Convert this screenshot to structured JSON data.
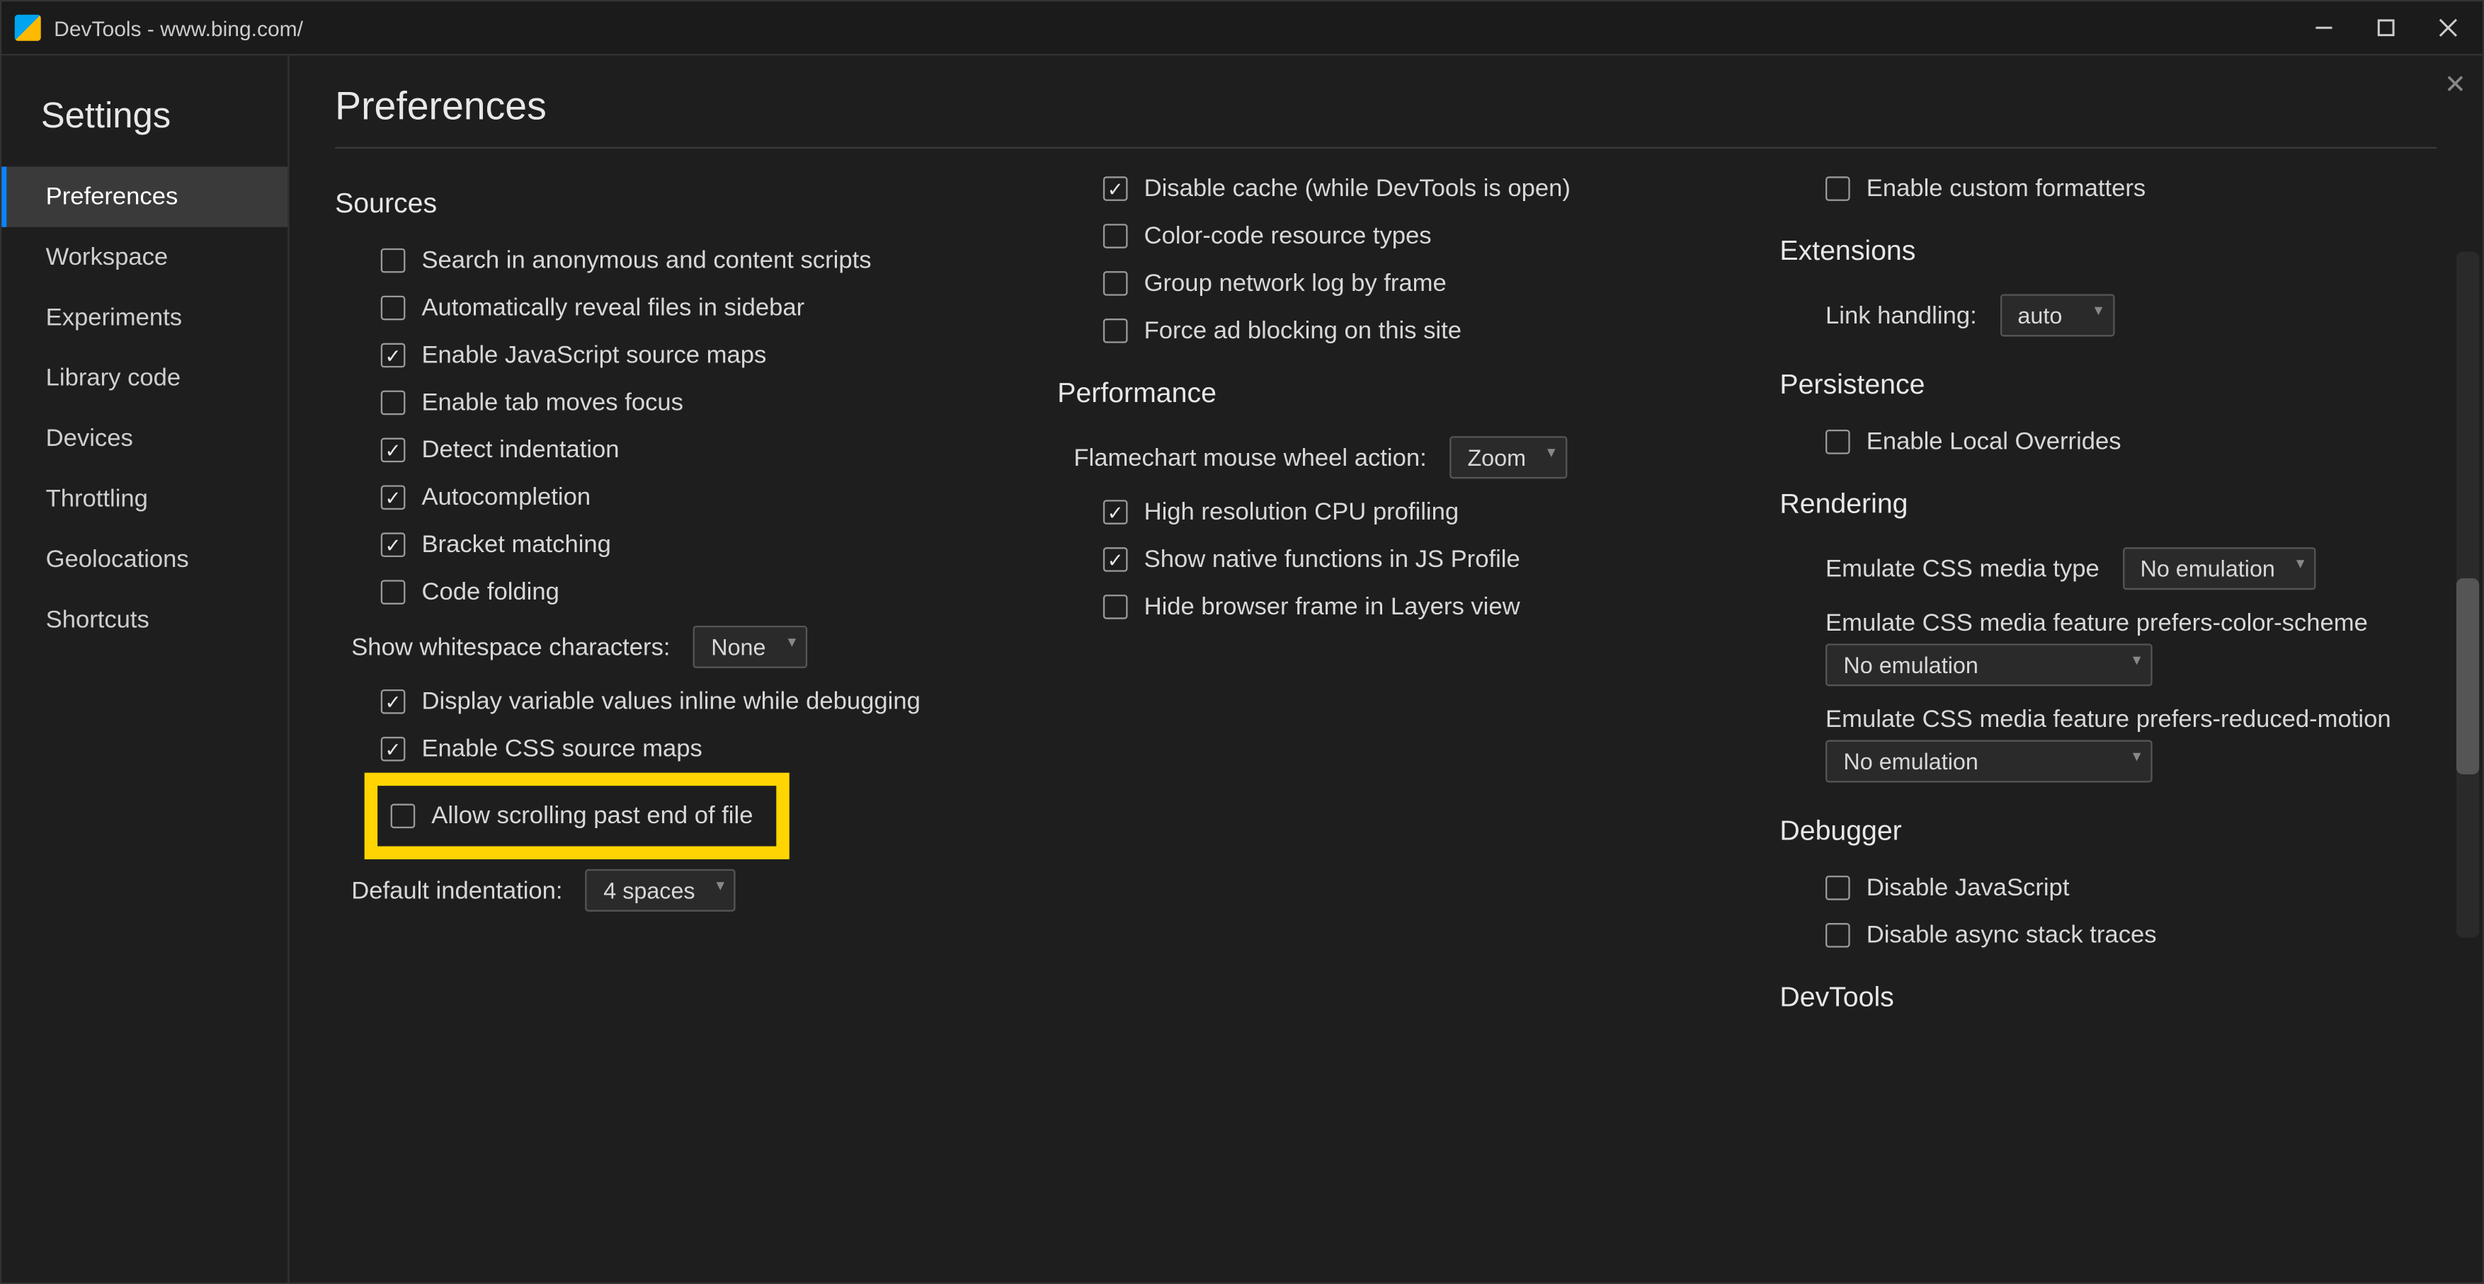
{
  "window": {
    "title": "DevTools - www.bing.com/"
  },
  "sidebar": {
    "title": "Settings",
    "items": [
      {
        "label": "Preferences",
        "selected": true
      },
      {
        "label": "Workspace"
      },
      {
        "label": "Experiments"
      },
      {
        "label": "Library code"
      },
      {
        "label": "Devices"
      },
      {
        "label": "Throttling"
      },
      {
        "label": "Geolocations"
      },
      {
        "label": "Shortcuts"
      }
    ]
  },
  "page": {
    "title": "Preferences"
  },
  "col1": {
    "section": "Sources",
    "items": {
      "search_anon": "Search in anonymous and content scripts",
      "auto_reveal": "Automatically reveal files in sidebar",
      "js_source_maps": "Enable JavaScript source maps",
      "tab_focus": "Enable tab moves focus",
      "detect_indent": "Detect indentation",
      "autocomplete": "Autocompletion",
      "bracket": "Bracket matching",
      "code_fold": "Code folding",
      "whitespace_label": "Show whitespace characters:",
      "whitespace_value": "None",
      "var_inline": "Display variable values inline while debugging",
      "css_source_maps": "Enable CSS source maps",
      "scroll_past": "Allow scrolling past end of file",
      "default_indent_label": "Default indentation:",
      "default_indent_value": "4 spaces"
    }
  },
  "col2": {
    "net": {
      "disable_cache": "Disable cache (while DevTools is open)",
      "color_code": "Color-code resource types",
      "group_by_frame": "Group network log by frame",
      "force_adblock": "Force ad blocking on this site"
    },
    "perf": {
      "title": "Performance",
      "wheel_label": "Flamechart mouse wheel action:",
      "wheel_value": "Zoom",
      "high_res": "High resolution CPU profiling",
      "native_fn": "Show native functions in JS Profile",
      "hide_frame": "Hide browser frame in Layers view"
    }
  },
  "col3": {
    "custom_fmt": "Enable custom formatters",
    "ext": {
      "title": "Extensions",
      "link_label": "Link handling:",
      "link_value": "auto"
    },
    "persist": {
      "title": "Persistence",
      "local_over": "Enable Local Overrides"
    },
    "render": {
      "title": "Rendering",
      "media_type_label": "Emulate CSS media type",
      "media_type_value": "No emulation",
      "color_scheme_label": "Emulate CSS media feature prefers-color-scheme",
      "color_scheme_value": "No emulation",
      "reduced_motion_label": "Emulate CSS media feature prefers-reduced-motion",
      "reduced_motion_value": "No emulation"
    },
    "debugger": {
      "title": "Debugger",
      "disable_js": "Disable JavaScript",
      "disable_async": "Disable async stack traces"
    },
    "devtools": {
      "title": "DevTools"
    }
  }
}
